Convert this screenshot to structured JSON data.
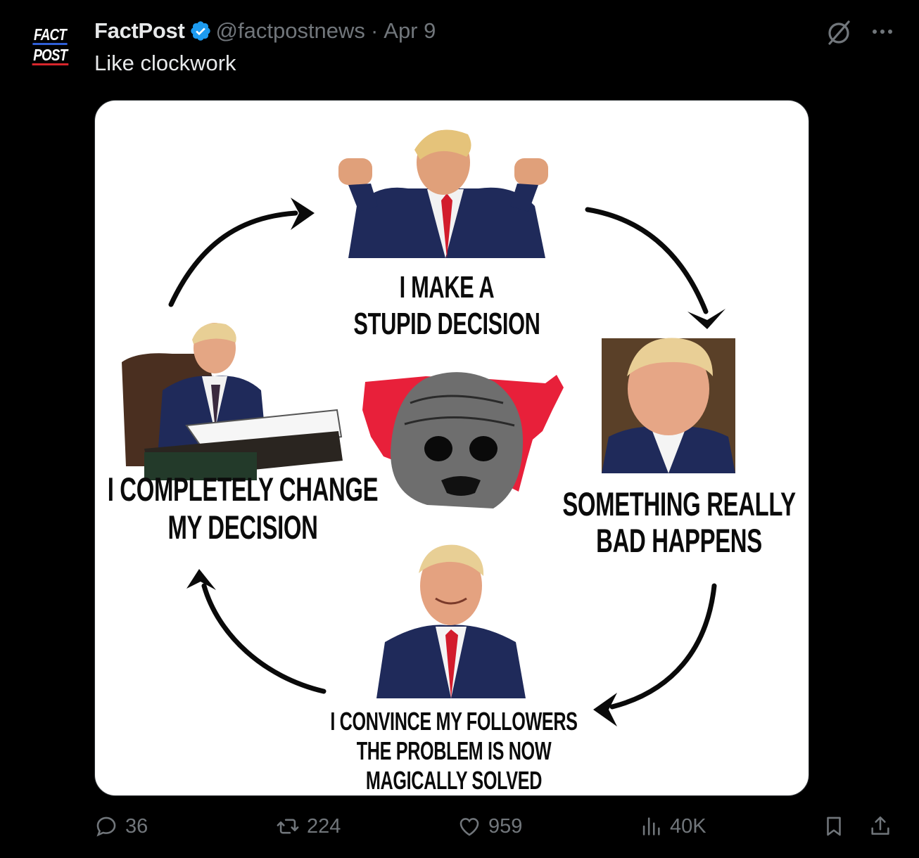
{
  "account": {
    "avatar_line1": "FACT",
    "avatar_line2": "POST",
    "name": "FactPost",
    "handle": "@factpostnews",
    "separator": "·",
    "date": "Apr 9"
  },
  "tweet": {
    "text": "Like clockwork"
  },
  "media": {
    "caption_top": "I MAKE A\nSTUPID DECISION",
    "caption_right": "SOMETHING REALLY\nBAD HAPPENS",
    "caption_bottom": "I CONVINCE MY FOLLOWERS\nTHE PROBLEM IS NOW\nMAGICALLY SOLVED",
    "caption_left": "I COMPLETELY CHANGE\nMY DECISION"
  },
  "actions": {
    "replies": "36",
    "reposts": "224",
    "likes": "959",
    "views": "40K"
  },
  "icons": {
    "verified": "verified-badge-icon",
    "grok": "grok-icon",
    "more": "more-icon",
    "reply": "reply-icon",
    "repost": "repost-icon",
    "like": "heart-icon",
    "views": "views-icon",
    "bookmark": "bookmark-icon",
    "share": "share-icon"
  },
  "colors": {
    "background": "#000000",
    "text": "#e7e9ea",
    "muted": "#71767b",
    "verified": "#1d9bf0",
    "map_red": "#e8203a"
  }
}
